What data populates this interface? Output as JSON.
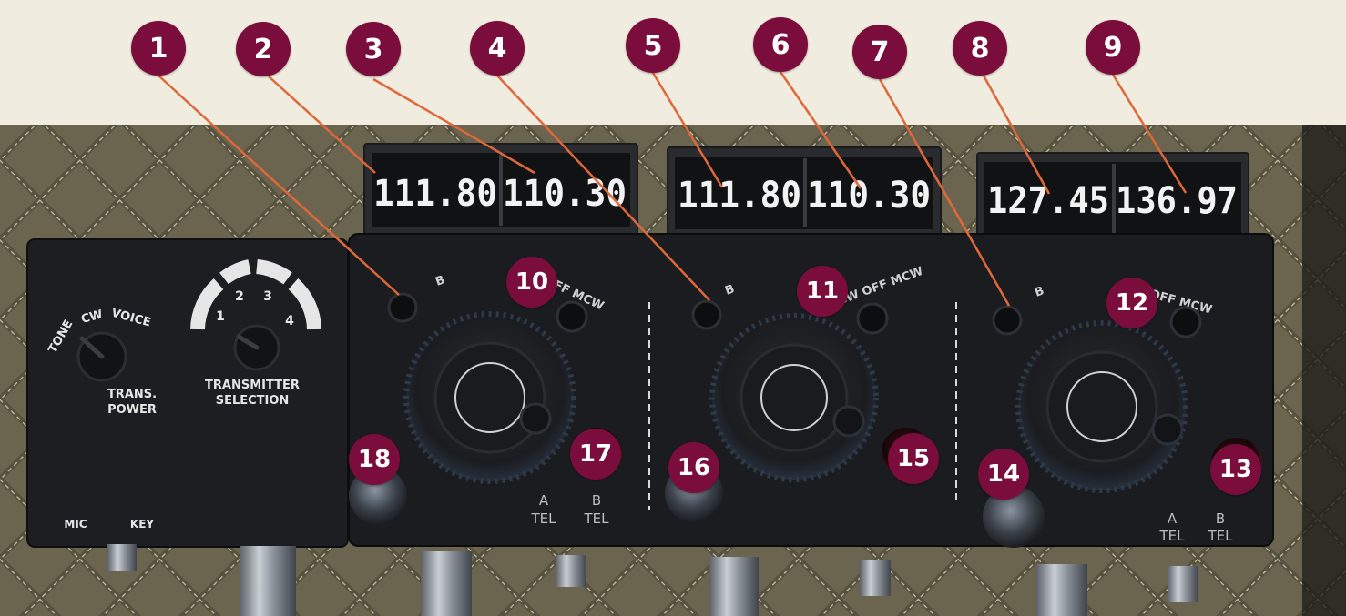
{
  "colors": {
    "background": "#f0ede0",
    "callout": "#7a0d3c",
    "leader_line": "#e0673a",
    "panel": "#1c1d20",
    "quilt": "#5c5744"
  },
  "frequency_displays": [
    {
      "left": "111.80",
      "right": "110.30"
    },
    {
      "left": "111.80",
      "right": "110.30"
    },
    {
      "left": "127.45",
      "right": "136.97"
    }
  ],
  "power_box": {
    "mode_labels": [
      "TONE",
      "CW",
      "VOICE"
    ],
    "power_label_1": "TRANS.",
    "power_label_2": "POWER",
    "selector_numbers": [
      "1",
      "2",
      "3",
      "4"
    ],
    "selection_label_1": "TRANSMITTER",
    "selection_label_2": "SELECTION",
    "mic_label": "MIC",
    "key_label": "KEY"
  },
  "receiver_labels": {
    "a_b_switch": "B",
    "mode_switch": "CW OFF MCW",
    "tel_a": "A",
    "tel_b": "B",
    "tel": "TEL"
  },
  "callouts": [
    {
      "number": "1",
      "target": "receiver-1-a-b-switch"
    },
    {
      "number": "2",
      "target": "receiver-1-frequency-display-left"
    },
    {
      "number": "3",
      "target": "receiver-1-frequency-display-right"
    },
    {
      "number": "4",
      "target": "receiver-2-a-b-switch"
    },
    {
      "number": "5",
      "target": "receiver-2-frequency-display-left"
    },
    {
      "number": "6",
      "target": "receiver-2-frequency-display-right"
    },
    {
      "number": "7",
      "target": "receiver-3-a-b-switch"
    },
    {
      "number": "8",
      "target": "receiver-3-frequency-display-left"
    },
    {
      "number": "9",
      "target": "receiver-3-frequency-display-right"
    },
    {
      "number": "10",
      "target": "receiver-1-mode-switch"
    },
    {
      "number": "11",
      "target": "receiver-2-mode-switch"
    },
    {
      "number": "12",
      "target": "receiver-3-mode-switch"
    },
    {
      "number": "13",
      "target": "receiver-3-red-knob"
    },
    {
      "number": "14",
      "target": "receiver-3-volume-knob"
    },
    {
      "number": "15",
      "target": "receiver-2-red-knob"
    },
    {
      "number": "16",
      "target": "receiver-2-volume-knob"
    },
    {
      "number": "17",
      "target": "receiver-1-red-knob"
    },
    {
      "number": "18",
      "target": "receiver-1-volume-knob"
    }
  ]
}
